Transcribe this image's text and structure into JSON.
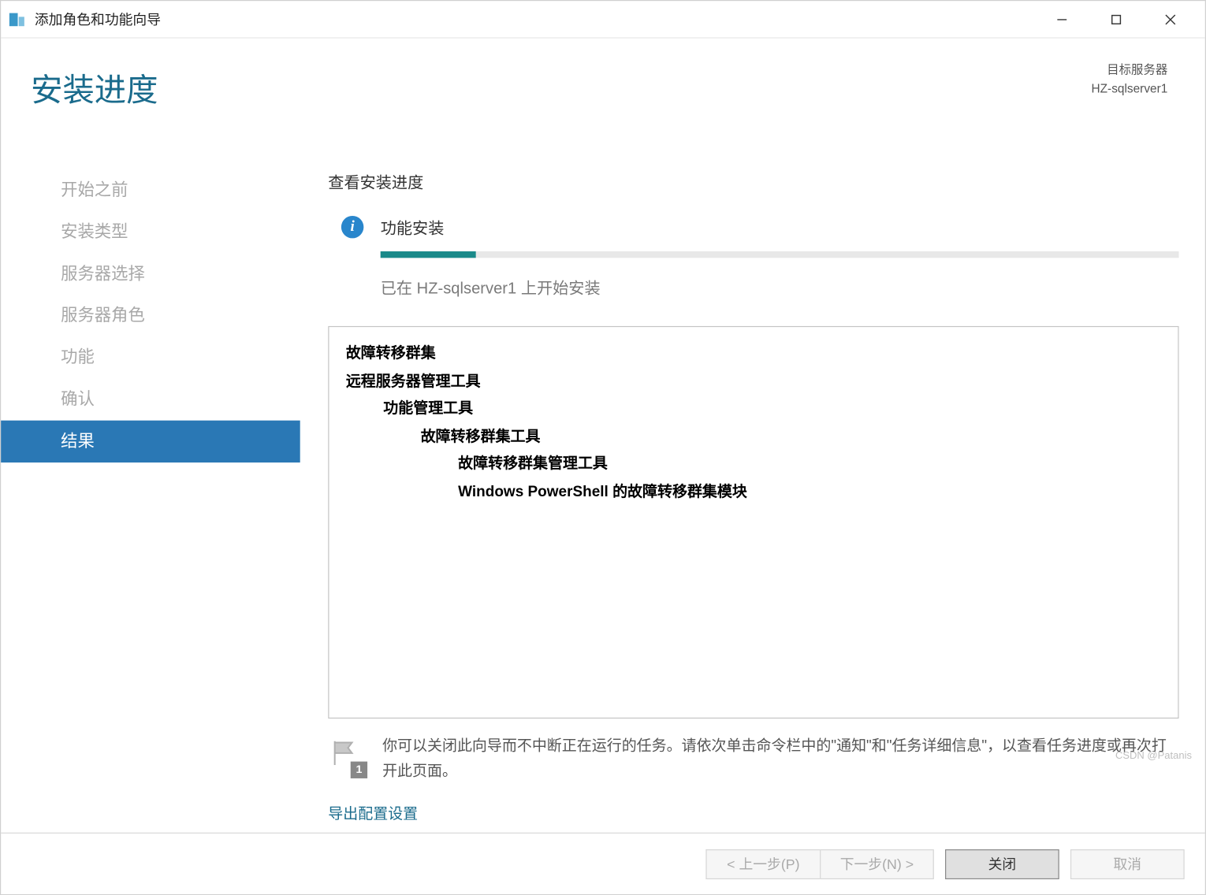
{
  "window": {
    "title": "添加角色和功能向导",
    "page_title": "安装进度",
    "target_label": "目标服务器",
    "target_server": "HZ-sqlserver1"
  },
  "sidebar": {
    "items": [
      {
        "label": "开始之前",
        "active": false
      },
      {
        "label": "安装类型",
        "active": false
      },
      {
        "label": "服务器选择",
        "active": false
      },
      {
        "label": "服务器角色",
        "active": false
      },
      {
        "label": "功能",
        "active": false
      },
      {
        "label": "确认",
        "active": false
      },
      {
        "label": "结果",
        "active": true
      }
    ]
  },
  "main": {
    "section_heading": "查看安装进度",
    "status_title": "功能安装",
    "status_text": "已在 HZ-sqlserver1 上开始安装",
    "progress_percent": 12,
    "details": [
      {
        "text": "故障转移群集",
        "indent": 0
      },
      {
        "text": "远程服务器管理工具",
        "indent": 0
      },
      {
        "text": "功能管理工具",
        "indent": 1
      },
      {
        "text": "故障转移群集工具",
        "indent": 2
      },
      {
        "text": "故障转移群集管理工具",
        "indent": 3
      },
      {
        "text": "Windows PowerShell 的故障转移群集模块",
        "indent": 3
      }
    ],
    "note_text": "你可以关闭此向导而不中断正在运行的任务。请依次单击命令栏中的\"通知\"和\"任务详细信息\"，以查看任务进度或再次打开此页面。",
    "flag_badge": "1",
    "export_link": "导出配置设置"
  },
  "footer": {
    "previous": "< 上一步(P)",
    "next": "下一步(N) >",
    "close": "关闭",
    "cancel": "取消"
  },
  "credit": "CSDN @Patanis"
}
